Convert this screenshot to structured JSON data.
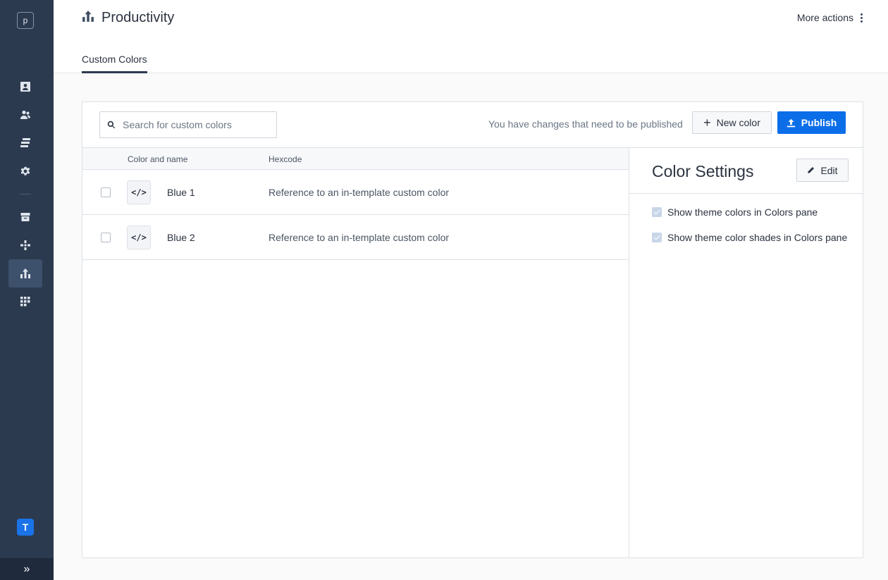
{
  "sidebar": {
    "logo_letter": "p",
    "brand_letter": "T",
    "items": [
      {
        "name": "contacts-icon"
      },
      {
        "name": "users-icon"
      },
      {
        "name": "layers-icon"
      },
      {
        "name": "gear-icon"
      },
      {
        "name": "archive-icon"
      },
      {
        "name": "cross-shape-icon"
      },
      {
        "name": "productivity-icon",
        "active": true
      },
      {
        "name": "grid-icon"
      }
    ],
    "expand_label": "»"
  },
  "header": {
    "title": "Productivity",
    "more_actions_label": "More actions",
    "tabs": [
      {
        "label": "Custom Colors",
        "active": true
      }
    ]
  },
  "toolbar": {
    "search_placeholder": "Search for custom colors",
    "changes_note": "You have changes that need to be published",
    "new_color_label": "New color",
    "publish_label": "Publish",
    "accent_color": "#0b6ee8"
  },
  "table": {
    "columns": [
      "Color and name",
      "Hexcode"
    ],
    "rows": [
      {
        "name": "Blue 1",
        "hexcode": "Reference to an in-template custom color",
        "icon_glyph": "</>"
      },
      {
        "name": "Blue 2",
        "hexcode": "Reference to an in-template custom color",
        "icon_glyph": "</>"
      }
    ]
  },
  "settings": {
    "title": "Color Settings",
    "edit_label": "Edit",
    "options": [
      {
        "label": "Show theme colors in Colors pane",
        "checked": true
      },
      {
        "label": "Show theme color shades in Colors pane",
        "checked": true
      }
    ]
  }
}
